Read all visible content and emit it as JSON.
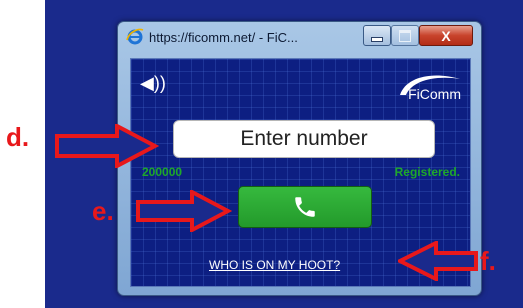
{
  "window": {
    "title": "https://ficomm.net/ - FiC..."
  },
  "app": {
    "logo_text": "FiComm",
    "number_input_placeholder": "Enter number",
    "extension_number": "200000",
    "registration_status": "Registered.",
    "hoot_link": "WHO IS ON MY HOOT?"
  },
  "annotations": {
    "d": "d.",
    "e": "e.",
    "f": "f."
  },
  "colors": {
    "background_panel": "#1a2a8c",
    "client_background": "#0d1f82",
    "status_green": "#1ea82a",
    "call_button_green": "#2aa834",
    "annotation_red": "#e8181b"
  },
  "icons": {
    "browser": "internet-explorer-icon",
    "speaker": "speaker-icon",
    "call": "phone-icon",
    "minimize": "minimize-icon",
    "maximize": "maximize-icon",
    "close": "close-icon"
  }
}
